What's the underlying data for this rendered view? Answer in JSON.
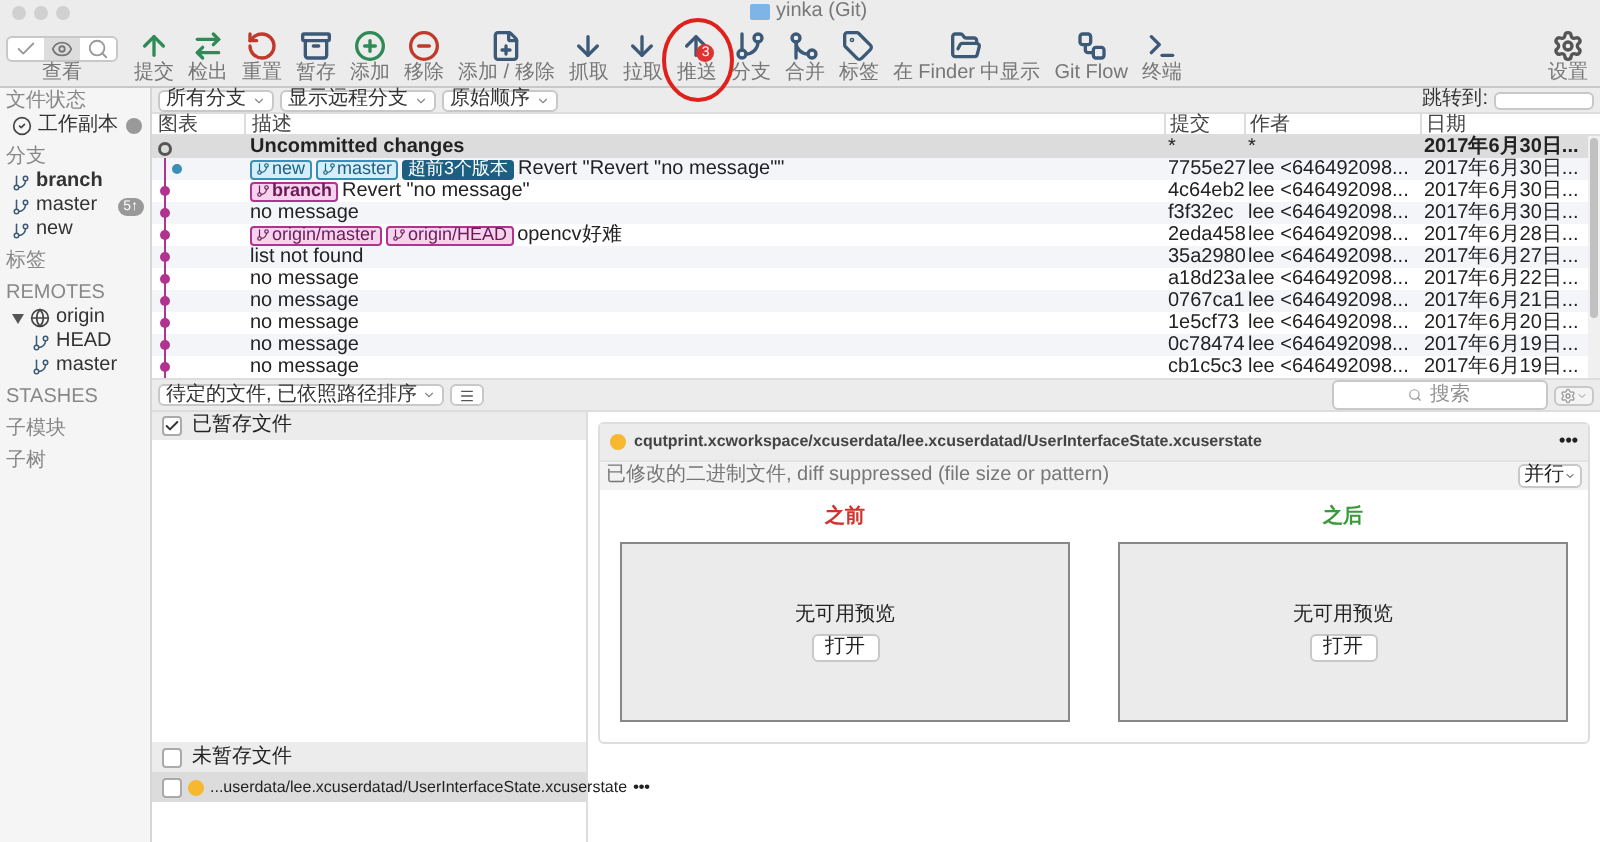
{
  "window": {
    "title": "yinka (Git)"
  },
  "toolbar": {
    "view_label": "查看",
    "buttons": [
      {
        "label": "提交",
        "circled": false
      },
      {
        "label": "检出",
        "circled": false
      },
      {
        "label": "重置",
        "circled": false
      },
      {
        "label": "暂存",
        "circled": false
      },
      {
        "label": "添加",
        "circled": false
      },
      {
        "label": "移除",
        "circled": false
      },
      {
        "label": "添加 / 移除",
        "circled": false
      },
      {
        "label": "抓取",
        "circled": false
      },
      {
        "label": "拉取",
        "circled": false
      },
      {
        "label": "推送",
        "circled": true,
        "badge": "3"
      },
      {
        "label": "分支",
        "circled": false
      },
      {
        "label": "合并",
        "circled": false
      },
      {
        "label": "标签",
        "circled": false
      },
      {
        "label": "在 Finder 中显示",
        "circled": false
      },
      {
        "label": "Git Flow",
        "circled": false
      },
      {
        "label": "终端",
        "circled": false
      }
    ],
    "settings_label": "设置"
  },
  "sidebar": {
    "sections": [
      {
        "title": "文件状态",
        "items": [
          {
            "label": "工作副本",
            "kind": "workspace",
            "current": false,
            "dot": true
          }
        ]
      },
      {
        "title": "分支",
        "items": [
          {
            "label": "branch",
            "kind": "branch",
            "current": true
          },
          {
            "label": "master",
            "kind": "branch",
            "current": false,
            "badge": "5↑"
          },
          {
            "label": "new",
            "kind": "branch",
            "current": false
          }
        ]
      },
      {
        "title": "标签"
      },
      {
        "title": "REMOTES",
        "items": [
          {
            "label": "origin",
            "kind": "remote",
            "current": false,
            "expanded": true,
            "children": [
              {
                "label": "HEAD",
                "kind": "branch",
                "current": false
              },
              {
                "label": "master",
                "kind": "branch",
                "current": false
              }
            ]
          }
        ]
      },
      {
        "title": "STASHES"
      },
      {
        "title": "子模块"
      },
      {
        "title": "子树"
      }
    ]
  },
  "filters": {
    "dropdowns": [
      "所有分支",
      "显示远程分支",
      "原始顺序"
    ],
    "jump_label": "跳转到:"
  },
  "table": {
    "columns": [
      "图表",
      "描述",
      "提交",
      "作者",
      "日期"
    ],
    "rows": [
      {
        "kind": "uncommitted",
        "selected": true,
        "color": "#555555",
        "tags": [],
        "description": "Uncommitted changes",
        "commit": "*",
        "author": "*",
        "date": "2017年6月30日..."
      },
      {
        "kind": "commit",
        "selected": false,
        "color": "#3a8fb7",
        "tags": [
          {
            "label": "new",
            "kind": "local"
          },
          {
            "label": "master",
            "kind": "local"
          },
          {
            "label": "超前3个版本",
            "kind": "ahead"
          }
        ],
        "description": "Revert \"Revert \"no message\"\"",
        "commit": "7755e27",
        "author": "lee <646492098...",
        "date": "2017年6月30日..."
      },
      {
        "kind": "commit",
        "selected": false,
        "color": "#b0338f",
        "tags": [
          {
            "label": "branch",
            "kind": "current"
          }
        ],
        "description": "Revert \"no message\"",
        "commit": "4c64eb2",
        "author": "lee <646492098...",
        "date": "2017年6月30日..."
      },
      {
        "kind": "commit",
        "selected": false,
        "color": "#b0338f",
        "tags": [],
        "description": "no message",
        "commit": "f3f32ec",
        "author": "lee <646492098...",
        "date": "2017年6月30日..."
      },
      {
        "kind": "commit",
        "selected": false,
        "color": "#b0338f",
        "tags": [
          {
            "label": "origin/master",
            "kind": "remote"
          },
          {
            "label": "origin/HEAD",
            "kind": "remote"
          }
        ],
        "description": "opencv好难",
        "commit": "2eda458",
        "author": "lee <646492098...",
        "date": "2017年6月28日..."
      },
      {
        "kind": "commit",
        "selected": false,
        "color": "#b0338f",
        "tags": [],
        "description": "list not found",
        "commit": "35a2980",
        "author": "lee <646492098...",
        "date": "2017年6月27日..."
      },
      {
        "kind": "commit",
        "selected": false,
        "color": "#b0338f",
        "tags": [],
        "description": "no message",
        "commit": "a18d23a",
        "author": "lee <646492098...",
        "date": "2017年6月22日..."
      },
      {
        "kind": "commit",
        "selected": false,
        "color": "#b0338f",
        "tags": [],
        "description": "no message",
        "commit": "0767ca1",
        "author": "lee <646492098...",
        "date": "2017年6月21日..."
      },
      {
        "kind": "commit",
        "selected": false,
        "color": "#b0338f",
        "tags": [],
        "description": "no message",
        "commit": "1e5cf73",
        "author": "lee <646492098...",
        "date": "2017年6月20日..."
      },
      {
        "kind": "commit",
        "selected": false,
        "color": "#b0338f",
        "tags": [],
        "description": "no message",
        "commit": "0c78474",
        "author": "lee <646492098...",
        "date": "2017年6月19日..."
      },
      {
        "kind": "commit",
        "selected": false,
        "color": "#b0338f",
        "tags": [],
        "description": "no message",
        "commit": "cb1c5c3",
        "author": "lee <646492098...",
        "date": "2017年6月19日..."
      }
    ]
  },
  "files_bar": {
    "sort": "待定的文件, 已依照路径排序",
    "search_placeholder": "搜索"
  },
  "staged": {
    "title": "已暂存文件",
    "checked": true
  },
  "unstaged": {
    "title": "未暂存文件",
    "checked": false,
    "files": [
      {
        "name": "...userdata/lee.xcuserdatad/UserInterfaceState.xcuserstate",
        "checked": false,
        "more": "•••"
      }
    ]
  },
  "diff": {
    "path": "cqutprint.xcworkspace/xcuserdata/lee.xcuserdatad/UserInterfaceState.xcuserstate",
    "more": "•••",
    "note": "已修改的二进制文件, diff suppressed (file size or pattern)",
    "mode": "并行",
    "panes": [
      {
        "title": "之前",
        "kind": "before",
        "message": "无可用预览",
        "button": "打开"
      },
      {
        "title": "之后",
        "kind": "after",
        "message": "无可用预览",
        "button": "打开"
      }
    ]
  }
}
